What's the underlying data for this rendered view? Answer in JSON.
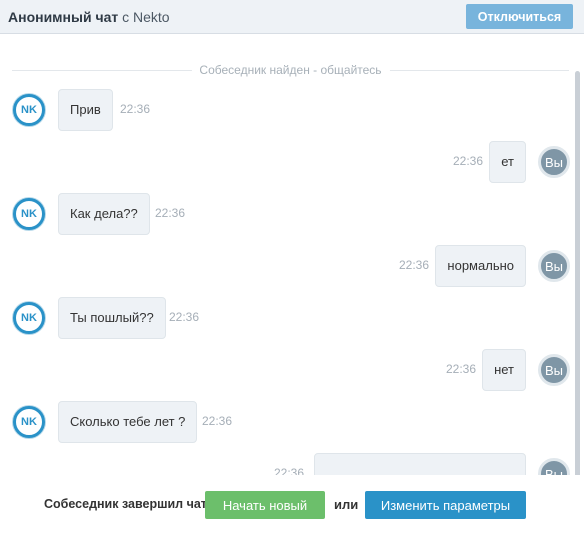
{
  "header": {
    "title_bold": "Анонимный чат",
    "title_rest": "с Nekto",
    "disconnect_label": "Отключиться"
  },
  "chat": {
    "divider_text": "Собеседник найден - общайтесь",
    "messages": [
      {
        "from": "partner",
        "avatar": "NK",
        "text": "Прив",
        "time": "22:36"
      },
      {
        "from": "me",
        "avatar": "Вы",
        "text": "ет",
        "time": "22:36"
      },
      {
        "from": "partner",
        "avatar": "NK",
        "text": "Как дела??",
        "time": "22:36"
      },
      {
        "from": "me",
        "avatar": "Вы",
        "text": "нормально",
        "time": "22:36"
      },
      {
        "from": "partner",
        "avatar": "NK",
        "text": "Ты пошлый??",
        "time": "22:36"
      },
      {
        "from": "me",
        "avatar": "Вы",
        "text": "нет",
        "time": "22:36"
      },
      {
        "from": "partner",
        "avatar": "NK",
        "text": "Сколько тебе лет ?",
        "time": "22:36"
      },
      {
        "from": "me",
        "avatar": "Вы",
        "text": "...",
        "time": "22:36"
      }
    ]
  },
  "footer": {
    "status": "Собеседник завершил чат:",
    "new_chat_label": "Начать новый",
    "or_label": "или",
    "change_params_label": "Изменить параметры"
  },
  "colors": {
    "accent": "#2a92c8",
    "green": "#6cbf6b",
    "disconnect": "#78b4dc"
  }
}
